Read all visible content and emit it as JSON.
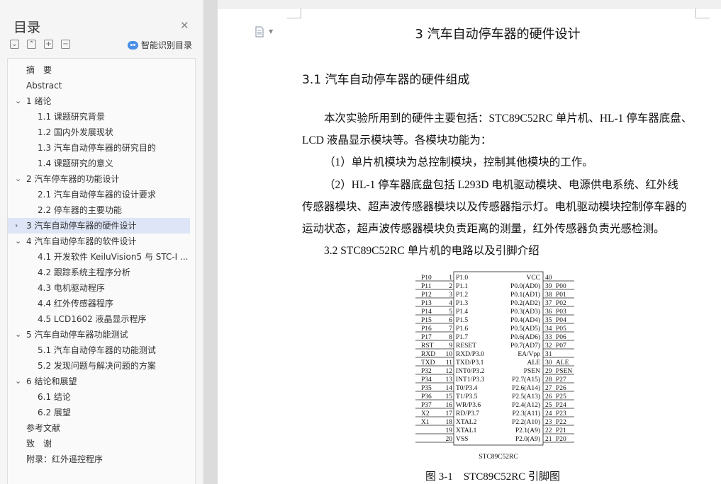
{
  "sidebar": {
    "title": "目录",
    "smart_label": "智能识别目录",
    "items": [
      {
        "label": "摘　要",
        "level": 0,
        "chevron": ""
      },
      {
        "label": "Abstract",
        "level": 0,
        "chevron": ""
      },
      {
        "label": "1 绪论",
        "level": 0,
        "chevron": "⌄"
      },
      {
        "label": "1.1 课题研究背景",
        "level": 1,
        "chevron": ""
      },
      {
        "label": "1.2 国内外发展现状",
        "level": 1,
        "chevron": ""
      },
      {
        "label": "1.3 汽车自动停车器的研究目的",
        "level": 1,
        "chevron": ""
      },
      {
        "label": "1.4 课题研究的意义",
        "level": 1,
        "chevron": ""
      },
      {
        "label": "2 汽车停车器的功能设计",
        "level": 0,
        "chevron": "⌄"
      },
      {
        "label": "2.1 汽车自动停车器的设计要求",
        "level": 1,
        "chevron": ""
      },
      {
        "label": "2.2 停车器的主要功能",
        "level": 1,
        "chevron": ""
      },
      {
        "label": "3 汽车自动停车器的硬件设计",
        "level": 0,
        "chevron": "›",
        "active": true
      },
      {
        "label": "4 汽车自动停车器的软件设计",
        "level": 0,
        "chevron": "⌄"
      },
      {
        "label": "4.1 开发软件 KeiluVision5 与 STC-I ...",
        "level": 1,
        "chevron": ""
      },
      {
        "label": "4.2 跟踪系统主程序分析",
        "level": 1,
        "chevron": ""
      },
      {
        "label": "4.3 电机驱动程序",
        "level": 1,
        "chevron": ""
      },
      {
        "label": "4.4 红外传感器程序",
        "level": 1,
        "chevron": ""
      },
      {
        "label": "4.5 LCD1602 液晶显示程序",
        "level": 1,
        "chevron": ""
      },
      {
        "label": "5 汽车自动停车器功能测试",
        "level": 0,
        "chevron": "⌄"
      },
      {
        "label": "5.1 汽车自动停车器的功能测试",
        "level": 1,
        "chevron": ""
      },
      {
        "label": "5.2 发现问题与解决问题的方案",
        "level": 1,
        "chevron": ""
      },
      {
        "label": "6 结论和展望",
        "level": 0,
        "chevron": "⌄"
      },
      {
        "label": "6.1 结论",
        "level": 1,
        "chevron": ""
      },
      {
        "label": "6.2 展望",
        "level": 1,
        "chevron": ""
      },
      {
        "label": "参考文献",
        "level": 0,
        "chevron": ""
      },
      {
        "label": "致　谢",
        "level": 0,
        "chevron": ""
      },
      {
        "label": "附录：红外遥控程序",
        "level": 0,
        "chevron": ""
      }
    ]
  },
  "document": {
    "chapter_title": "3 汽车自动停车器的硬件设计",
    "section_title": "3.1 汽车自动停车器的硬件组成",
    "lines": [
      "本次实验所用到的硬件主要包括：STC89C52RC 单片机、HL-1 停车器底盘、",
      "LCD 液晶显示模块等。各模块功能为：",
      "（1）单片机模块为总控制模块，控制其他模块的工作。",
      "（2）HL-1 停车器底盘包括 L293D 电机驱动模块、电源供电系统、红外线",
      "传感器模块、超声波传感器模块以及传感器指示灯。电机驱动模块控制停车器的",
      "运动状态，超声波传感器模块负责距离的测量，红外传感器负责光感检测。",
      "3.2 STC89C52RC 单片机的电路以及引脚介绍"
    ],
    "figure_caption": "图 3-1　STC89C52RC 引脚图"
  },
  "chip": {
    "name": "STC89C52RC",
    "left_pins": [
      {
        "num": "1",
        "inside": "P1.0",
        "outside": "P10"
      },
      {
        "num": "2",
        "inside": "P1.1",
        "outside": "P11"
      },
      {
        "num": "3",
        "inside": "P1.2",
        "outside": "P12"
      },
      {
        "num": "4",
        "inside": "P1.3",
        "outside": "P13"
      },
      {
        "num": "5",
        "inside": "P1.4",
        "outside": "P14"
      },
      {
        "num": "6",
        "inside": "P1.5",
        "outside": "P15"
      },
      {
        "num": "7",
        "inside": "P1.6",
        "outside": "P16"
      },
      {
        "num": "8",
        "inside": "P1.7",
        "outside": "P17"
      },
      {
        "num": "9",
        "inside": "RESET",
        "outside": "RST"
      },
      {
        "num": "10",
        "inside": "RXD/P3.0",
        "outside": "RXD"
      },
      {
        "num": "11",
        "inside": "TXD/P3.1",
        "outside": "TXD"
      },
      {
        "num": "12",
        "inside": "INT0/P3.2",
        "outside": "P32"
      },
      {
        "num": "13",
        "inside": "INT1/P3.3",
        "outside": "P34"
      },
      {
        "num": "14",
        "inside": "T0/P3.4",
        "outside": "P35"
      },
      {
        "num": "15",
        "inside": "T1/P3.5",
        "outside": "P36"
      },
      {
        "num": "16",
        "inside": "WR/P3.6",
        "outside": "P37"
      },
      {
        "num": "17",
        "inside": "RD/P3.7",
        "outside": "X2"
      },
      {
        "num": "18",
        "inside": "XTAL2",
        "outside": "X1"
      },
      {
        "num": "19",
        "inside": "XTAL1",
        "outside": ""
      },
      {
        "num": "20",
        "inside": "VSS",
        "outside": ""
      }
    ],
    "right_pins": [
      {
        "num": "40",
        "inside": "VCC",
        "outside": ""
      },
      {
        "num": "39",
        "inside": "P0.0(AD0)",
        "outside": "P00"
      },
      {
        "num": "38",
        "inside": "P0.1(AD1)",
        "outside": "P01"
      },
      {
        "num": "37",
        "inside": "P0.2(AD2)",
        "outside": "P02"
      },
      {
        "num": "36",
        "inside": "P0.3(AD3)",
        "outside": "P03"
      },
      {
        "num": "35",
        "inside": "P0.4(AD4)",
        "outside": "P04"
      },
      {
        "num": "34",
        "inside": "P0.5(AD5)",
        "outside": "P05"
      },
      {
        "num": "33",
        "inside": "P0.6(AD6)",
        "outside": "P06"
      },
      {
        "num": "32",
        "inside": "P0.7(AD7)",
        "outside": "P07"
      },
      {
        "num": "31",
        "inside": "EA/Vpp",
        "outside": ""
      },
      {
        "num": "30",
        "inside": "ALE",
        "outside": "ALE"
      },
      {
        "num": "29",
        "inside": "PSEN",
        "outside": "PSEN"
      },
      {
        "num": "28",
        "inside": "P2.7(A15)",
        "outside": "P27"
      },
      {
        "num": "27",
        "inside": "P2.6(A14)",
        "outside": "P26"
      },
      {
        "num": "26",
        "inside": "P2.5(A13)",
        "outside": "P25"
      },
      {
        "num": "25",
        "inside": "P2.4(A12)",
        "outside": "P24"
      },
      {
        "num": "24",
        "inside": "P2.3(A11)",
        "outside": "P23"
      },
      {
        "num": "23",
        "inside": "P2.2(A10)",
        "outside": "P22"
      },
      {
        "num": "22",
        "inside": "P2.1(A9)",
        "outside": "P21"
      },
      {
        "num": "21",
        "inside": "P2.0(A9)",
        "outside": "P20"
      }
    ]
  }
}
